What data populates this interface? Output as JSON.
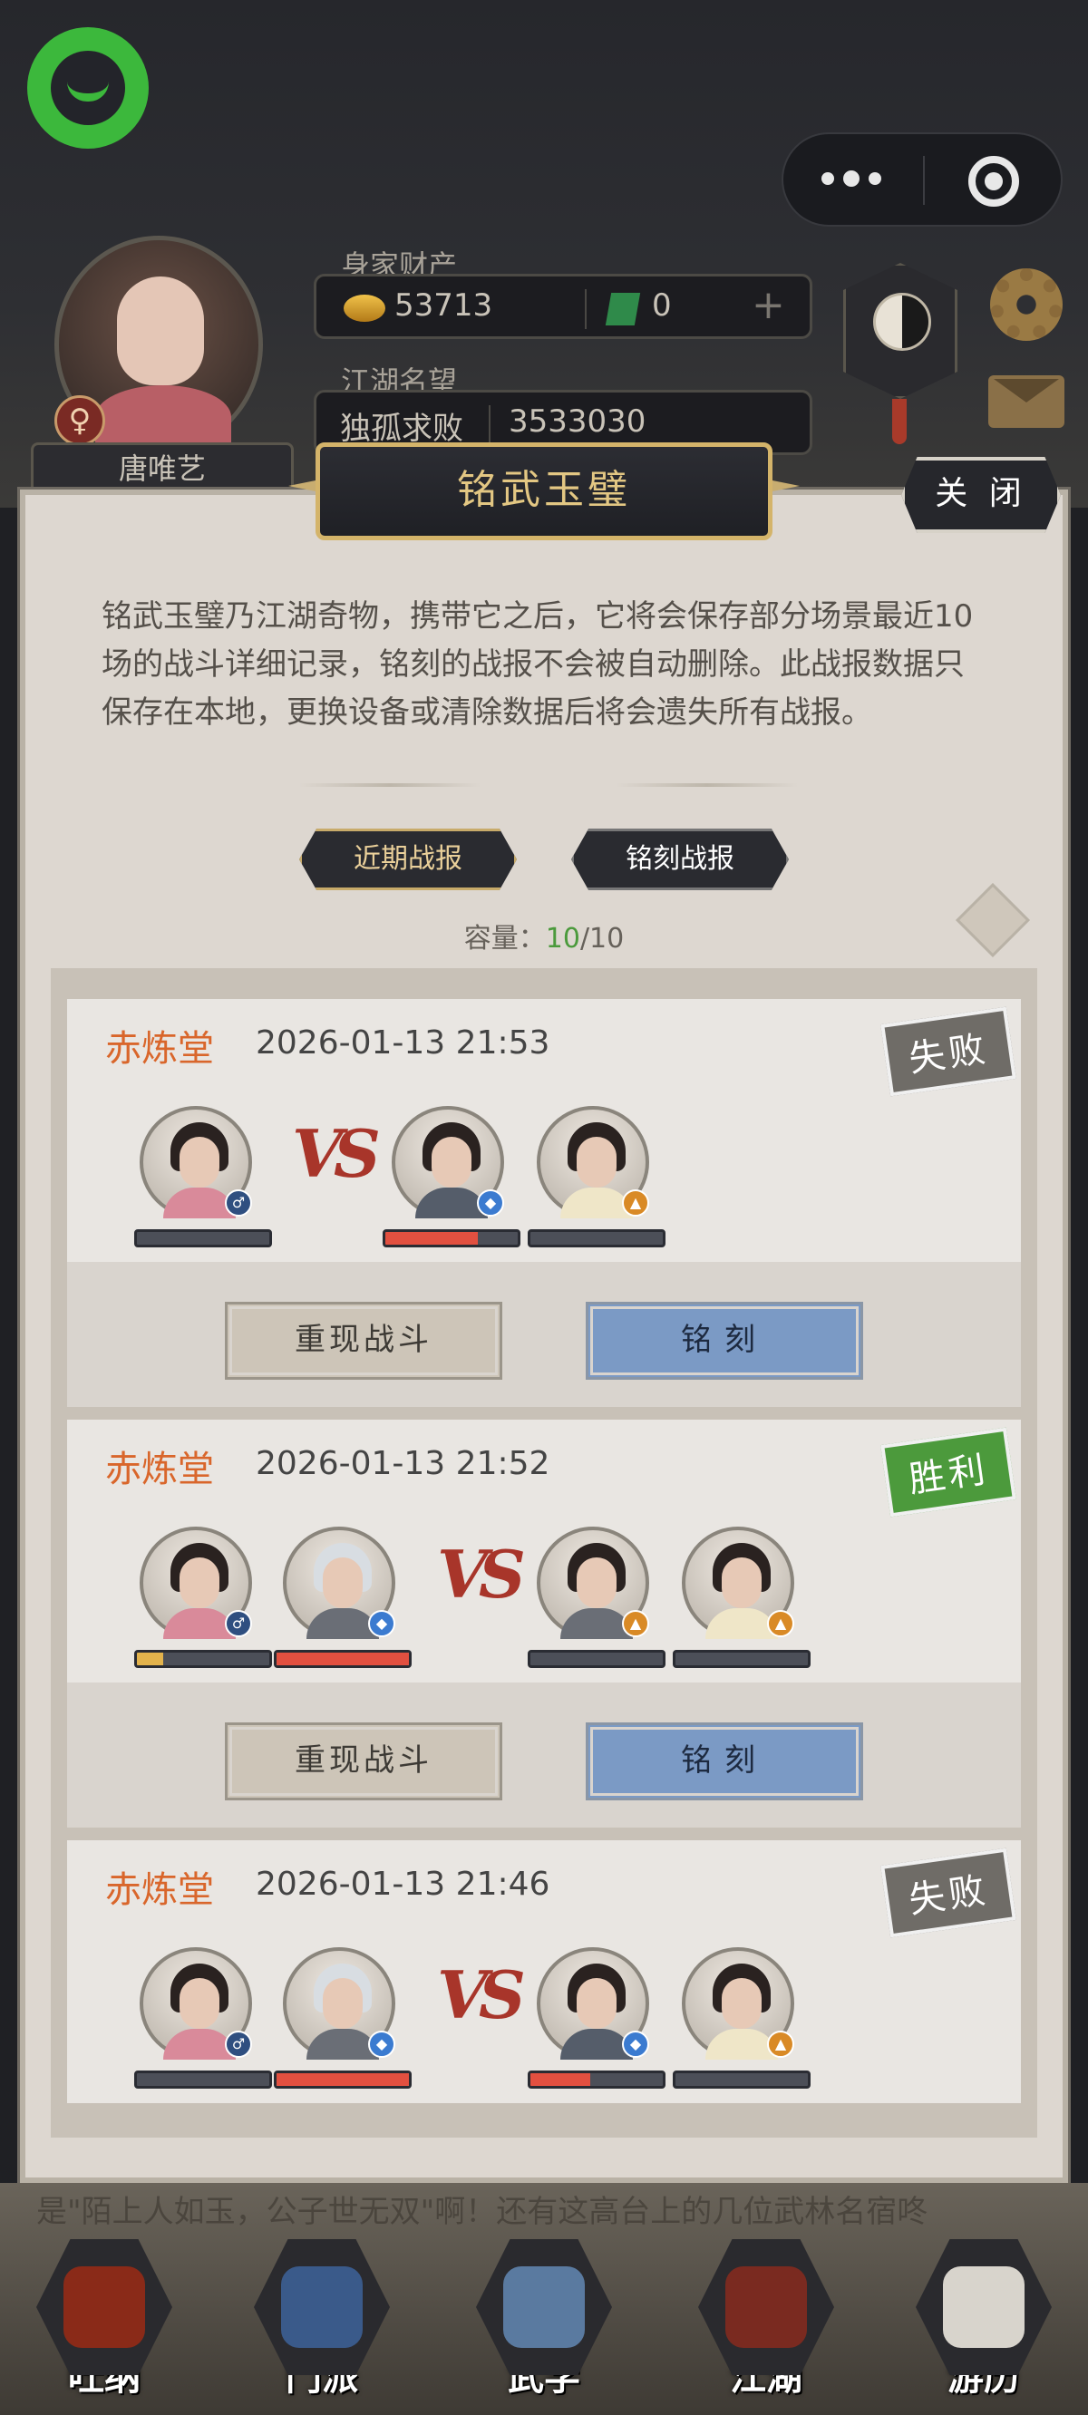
{
  "header": {
    "player_name": "唐唯艺",
    "gender_symbol": "♀",
    "wealth_label": "身家财产",
    "gold": "53713",
    "jade": "0",
    "add_label": "+",
    "fame_label": "江湖名望",
    "fame_title": "独孤求败",
    "fame_value": "3533030"
  },
  "modal": {
    "title": "铭武玉璧",
    "close_label": "关 闭",
    "description": "铭武玉璧乃江湖奇物，携带它之后，它将会保存部分场景最近10场的战斗详细记录，铭刻的战报不会被自动删除。此战报数据只保存在本地，更换设备或清除数据后将会遗失所有战报。",
    "tabs": [
      "近期战报",
      "铭刻战报"
    ],
    "capacity_label": "容量：",
    "capacity_used": "10",
    "capacity_total": "/10"
  },
  "records": [
    {
      "sect": "赤炼堂",
      "time": "2026-01-13 21:53",
      "result": "失败",
      "replay_label": "重现战斗",
      "engrave_label": "铭刻",
      "left_hp": [
        0
      ],
      "right_hp": [
        0.7,
        0
      ],
      "vs": "VS"
    },
    {
      "sect": "赤炼堂",
      "time": "2026-01-13 21:52",
      "result": "胜利",
      "replay_label": "重现战斗",
      "engrave_label": "铭刻",
      "left_hp": [
        0.2,
        1.0
      ],
      "right_hp": [
        0,
        0
      ],
      "vs": "VS"
    },
    {
      "sect": "赤炼堂",
      "time": "2026-01-13 21:46",
      "result": "失败",
      "left_hp": [
        0,
        1.0
      ],
      "right_hp": [
        0.45,
        0
      ],
      "vs": "VS"
    }
  ],
  "ticker": "是\"陌上人如玉，公子世无双\"啊！还有这高台上的几位武林名宿咚",
  "nav": [
    {
      "label": "吐纳",
      "color": "#8a2a18"
    },
    {
      "label": "门派",
      "color": "#3a5a8a"
    },
    {
      "label": "武学",
      "color": "#5a7aa0"
    },
    {
      "label": "江湖",
      "color": "#7a2a20"
    },
    {
      "label": "游历",
      "color": "#d8d4cc"
    }
  ]
}
